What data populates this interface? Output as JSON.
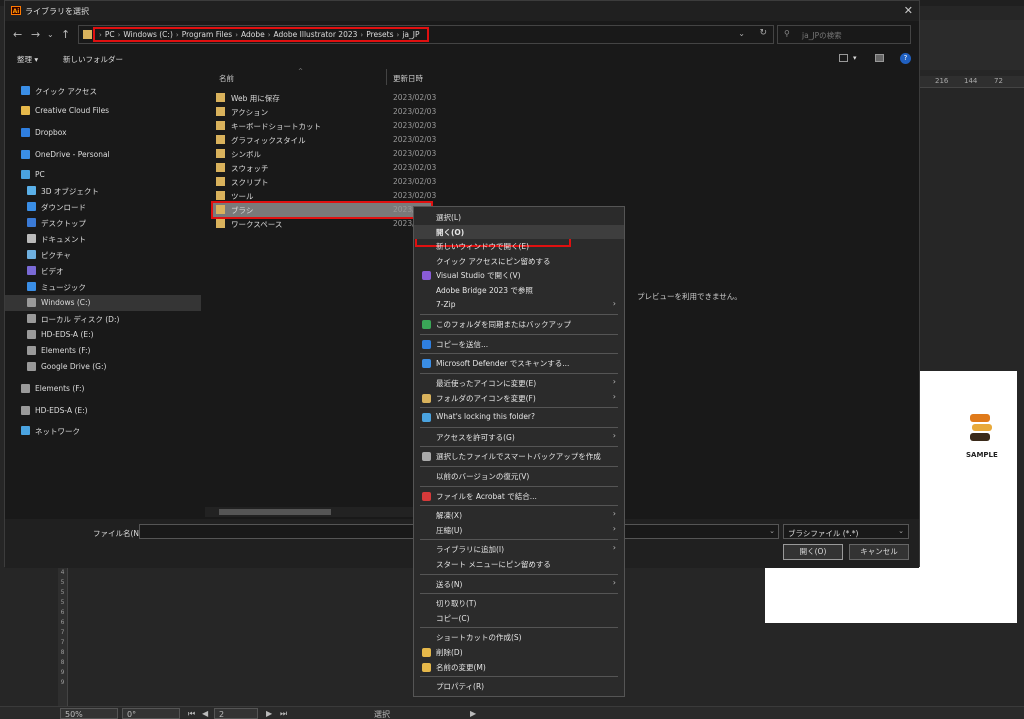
{
  "dialog": {
    "title": "ライブラリを選択",
    "close_glyph": "✕"
  },
  "nav": {
    "back_glyph": "←",
    "forward_glyph": "→",
    "down_glyph": "⌄",
    "up_glyph": "↑",
    "breadcrumbs": [
      "PC",
      "Windows (C:)",
      "Program Files",
      "Adobe",
      "Adobe Illustrator 2023",
      "Presets",
      "ja_JP"
    ],
    "sep_glyph": "›",
    "addr_down_glyph": "⌄",
    "refresh_glyph": "↻",
    "search_placeholder": "ja_JPの検索",
    "search_glyph": "⚲"
  },
  "cmdbar": {
    "organize": "整理 ▾",
    "new_folder": "新しいフォルダー",
    "help": "?"
  },
  "sidebar": [
    {
      "label": "クイック アクセス",
      "icon": "star-icon",
      "color": "#3a8ee6",
      "indent": 0
    },
    {
      "label": "Creative Cloud Files",
      "icon": "creative-cloud-icon",
      "color": "#e6b84a",
      "indent": 0
    },
    {
      "label": "Dropbox",
      "icon": "dropbox-icon",
      "color": "#2f7fe0",
      "indent": 0
    },
    {
      "label": "OneDrive - Personal",
      "icon": "onedrive-icon",
      "color": "#3a8ee6",
      "indent": 0
    },
    {
      "label": "PC",
      "icon": "pc-icon",
      "color": "#4aa3e0",
      "indent": 0
    },
    {
      "label": "3D オブジェクト",
      "icon": "3d-objects-icon",
      "color": "#5ab0e8",
      "indent": 1
    },
    {
      "label": "ダウンロード",
      "icon": "download-icon",
      "color": "#3a8ee6",
      "indent": 1
    },
    {
      "label": "デスクトップ",
      "icon": "desktop-icon",
      "color": "#3a7ad6",
      "indent": 1
    },
    {
      "label": "ドキュメント",
      "icon": "documents-icon",
      "color": "#bbbbbb",
      "indent": 1
    },
    {
      "label": "ピクチャ",
      "icon": "pictures-icon",
      "color": "#6fb0e0",
      "indent": 1
    },
    {
      "label": "ビデオ",
      "icon": "videos-icon",
      "color": "#7a6ad6",
      "indent": 1
    },
    {
      "label": "ミュージック",
      "icon": "music-icon",
      "color": "#3a8ee6",
      "indent": 1
    },
    {
      "label": "Windows (C:)",
      "icon": "drive-icon",
      "color": "#9a9a9a",
      "indent": 1,
      "selected": true
    },
    {
      "label": "ローカル ディスク (D:)",
      "icon": "drive-icon",
      "color": "#9a9a9a",
      "indent": 1
    },
    {
      "label": "HD-EDS-A (E:)",
      "icon": "drive-icon",
      "color": "#9a9a9a",
      "indent": 1
    },
    {
      "label": "Elements (F:)",
      "icon": "drive-icon",
      "color": "#9a9a9a",
      "indent": 1
    },
    {
      "label": "Google Drive (G:)",
      "icon": "drive-icon",
      "color": "#9a9a9a",
      "indent": 1
    },
    {
      "label": "Elements (F:)",
      "icon": "drive-icon",
      "color": "#9a9a9a",
      "indent": 0
    },
    {
      "label": "HD-EDS-A (E:)",
      "icon": "drive-icon",
      "color": "#9a9a9a",
      "indent": 0
    },
    {
      "label": "ネットワーク",
      "icon": "network-icon",
      "color": "#4aa3e0",
      "indent": 0
    }
  ],
  "filelist": {
    "col_name": "名前",
    "col_date": "更新日時",
    "files": [
      {
        "name": "Web 用に保存",
        "date": "2023/02/03"
      },
      {
        "name": "アクション",
        "date": "2023/02/03"
      },
      {
        "name": "キーボードショートカット",
        "date": "2023/02/03"
      },
      {
        "name": "グラフィックスタイル",
        "date": "2023/02/03"
      },
      {
        "name": "シンボル",
        "date": "2023/02/03"
      },
      {
        "name": "スウォッチ",
        "date": "2023/02/03"
      },
      {
        "name": "スクリプト",
        "date": "2023/02/03"
      },
      {
        "name": "ツール",
        "date": "2023/02/03"
      },
      {
        "name": "ブラシ",
        "date": "2023/02/03",
        "selected": true
      },
      {
        "name": "ワークスペース",
        "date": "2023/02/03"
      }
    ]
  },
  "preview_unavailable": "プレビューを利用できません。",
  "footer": {
    "filename_label": "ファイル名(N):",
    "filename_value": "",
    "filetype": "ブラシファイル (*.*)",
    "open": "開く(O)",
    "cancel": "キャンセル",
    "dropdown_glyph": "⌄"
  },
  "context_menu": [
    {
      "label": "選択(L)"
    },
    {
      "label": "開く(O)",
      "hover": true,
      "bold": true
    },
    {
      "label": "新しいウィンドウで開く(E)"
    },
    {
      "label": "クイック アクセスにピン留めする"
    },
    {
      "label": "Visual Studio で開く(V)",
      "icon": "visual-studio-icon",
      "color": "#8a5cd6"
    },
    {
      "label": "Adobe Bridge 2023 で参照"
    },
    {
      "label": "7-Zip",
      "submenu": true
    },
    {
      "sep": true
    },
    {
      "label": "このフォルダを同期またはバックアップ",
      "icon": "google-drive-icon",
      "color": "#3aa757"
    },
    {
      "sep": true
    },
    {
      "label": "コピーを送信...",
      "icon": "dropbox-icon",
      "color": "#2f7fe0"
    },
    {
      "sep": true
    },
    {
      "label": "Microsoft Defender でスキャンする...",
      "icon": "defender-icon",
      "color": "#3a8ee6"
    },
    {
      "sep": true
    },
    {
      "label": "最近使ったアイコンに変更(E)",
      "submenu": true
    },
    {
      "label": "フォルダのアイコンを変更(F)",
      "icon": "folder-color-icon",
      "color": "#d9b25c",
      "submenu": true
    },
    {
      "sep": true
    },
    {
      "label": "What's locking this folder?",
      "icon": "lock-search-icon",
      "color": "#4aa3e0"
    },
    {
      "sep": true
    },
    {
      "label": "アクセスを許可する(G)",
      "submenu": true
    },
    {
      "sep": true
    },
    {
      "label": "選択したファイルでスマートバックアップを作成",
      "icon": "backup-icon",
      "color": "#aaaaaa"
    },
    {
      "sep": true
    },
    {
      "label": "以前のバージョンの復元(V)"
    },
    {
      "sep": true
    },
    {
      "label": "ファイルを Acrobat で結合...",
      "icon": "acrobat-icon",
      "color": "#d63a3a"
    },
    {
      "sep": true
    },
    {
      "label": "解凍(X)",
      "submenu": true
    },
    {
      "label": "圧縮(U)",
      "submenu": true
    },
    {
      "sep": true
    },
    {
      "label": "ライブラリに追加(I)",
      "submenu": true
    },
    {
      "label": "スタート メニューにピン留めする"
    },
    {
      "sep": true
    },
    {
      "label": "送る(N)",
      "submenu": true
    },
    {
      "sep": true
    },
    {
      "label": "切り取り(T)"
    },
    {
      "label": "コピー(C)"
    },
    {
      "sep": true
    },
    {
      "label": "ショートカットの作成(S)"
    },
    {
      "label": "削除(D)",
      "icon": "shield-icon",
      "color": "#e6b84a"
    },
    {
      "label": "名前の変更(M)",
      "icon": "shield-icon",
      "color": "#e6b84a"
    },
    {
      "sep": true
    },
    {
      "label": "プロパティ(R)"
    }
  ],
  "background": {
    "ruler_numbers": [
      "216",
      "144",
      "72"
    ],
    "left_ruler": [
      "4",
      "5",
      "5",
      "5",
      "6",
      "6",
      "7",
      "7",
      "8",
      "8",
      "9",
      "9"
    ],
    "sample_text": "SAMPLE",
    "status": {
      "zoom": "50%",
      "rotation": "0°",
      "page": "2",
      "mode": "選択"
    }
  }
}
